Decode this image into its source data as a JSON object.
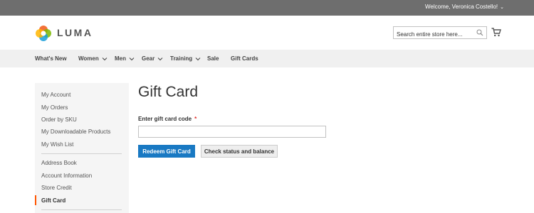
{
  "topbar": {
    "welcome_text": "Welcome, Veronica Costello!",
    "chevron_icon": "chevron-down-icon"
  },
  "header": {
    "logo_text": "LUMA",
    "search_placeholder": "Search entire store here...",
    "search_icon": "search-icon",
    "cart_icon": "cart-icon"
  },
  "nav": {
    "items": [
      {
        "label": "What's New",
        "has_dropdown": false
      },
      {
        "label": "Women",
        "has_dropdown": true
      },
      {
        "label": "Men",
        "has_dropdown": true
      },
      {
        "label": "Gear",
        "has_dropdown": true
      },
      {
        "label": "Training",
        "has_dropdown": true
      },
      {
        "label": "Sale",
        "has_dropdown": false
      },
      {
        "label": "Gift Cards",
        "has_dropdown": false
      }
    ]
  },
  "sidebar": {
    "group1": [
      "My Account",
      "My Orders",
      "Order by SKU",
      "My Downloadable Products",
      "My Wish List"
    ],
    "group2": [
      "Address Book",
      "Account Information",
      "Store Credit",
      "Gift Card"
    ],
    "active_item": "Gift Card"
  },
  "main": {
    "title": "Gift Card",
    "field_label": "Enter gift card code",
    "required_mark": "*",
    "code_value": "",
    "redeem_button": "Redeem Gift Card",
    "check_button": "Check status and balance"
  },
  "colors": {
    "topbar": "#6e6e6e",
    "nav_bg": "#f0f0f0",
    "sidebar_bg": "#f5f5f5",
    "primary_button": "#1979c3",
    "active_accent": "#ff5501",
    "required": "#e02b27"
  }
}
